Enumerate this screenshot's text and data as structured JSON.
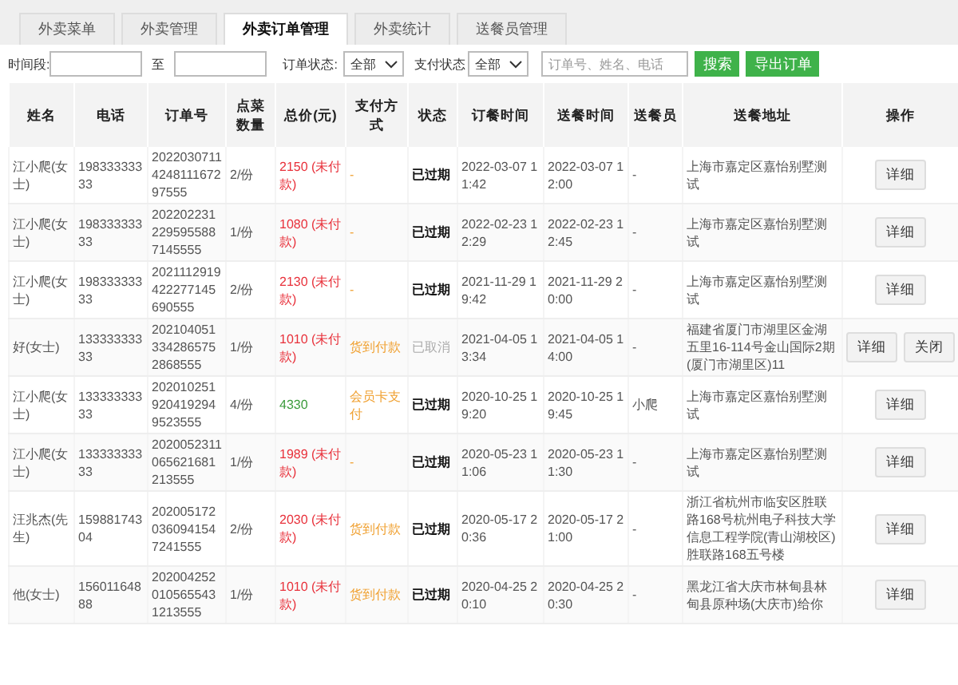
{
  "tabs": [
    {
      "label": "外卖菜单",
      "selected": false
    },
    {
      "label": "外卖管理",
      "selected": false
    },
    {
      "label": "外卖订单管理",
      "selected": true
    },
    {
      "label": "外卖统计",
      "selected": false
    },
    {
      "label": "送餐员管理",
      "selected": false
    }
  ],
  "filters": {
    "period_label": "时间段:",
    "to_label": "至",
    "order_status_label": "订单状态:",
    "order_status_value": "全部",
    "pay_status_label": "支付状态",
    "pay_status_value": "全部",
    "search_placeholder": "订单号、姓名、电话",
    "search_button": "搜索",
    "export_button": "导出订单"
  },
  "table": {
    "columns": [
      "姓名",
      "电话",
      "订单号",
      "点菜数量",
      "总价(元)",
      "支付方式",
      "状态",
      "订餐时间",
      "送餐时间",
      "送餐员",
      "送餐地址",
      "操作"
    ],
    "rows": [
      {
        "name": "江小爬(女士)",
        "phone": "19833333333",
        "order_no": "2022030711424811167297555",
        "quantity": "2/份",
        "total": "2150 (未付款)",
        "paid": false,
        "payment": "-",
        "status": "已过期",
        "cancelled": false,
        "order_time": "2022-03-07 11:42",
        "delivery_time": "2022-03-07 12:00",
        "courier": "-",
        "address": "上海市嘉定区嘉怡别墅测试",
        "actions": [
          "详细"
        ]
      },
      {
        "name": "江小爬(女士)",
        "phone": "19833333333",
        "order_no": "2022022312295955887145555",
        "quantity": "1/份",
        "total": "1080 (未付款)",
        "paid": false,
        "payment": "-",
        "status": "已过期",
        "cancelled": false,
        "order_time": "2022-02-23 12:29",
        "delivery_time": "2022-02-23 12:45",
        "courier": "-",
        "address": "上海市嘉定区嘉怡别墅测试",
        "actions": [
          "详细"
        ]
      },
      {
        "name": "江小爬(女士)",
        "phone": "19833333333",
        "order_no": "2021112919422277145690555",
        "quantity": "2/份",
        "total": "2130 (未付款)",
        "paid": false,
        "payment": "-",
        "status": "已过期",
        "cancelled": false,
        "order_time": "2021-11-29 19:42",
        "delivery_time": "2021-11-29 20:00",
        "courier": "-",
        "address": "上海市嘉定区嘉怡别墅测试",
        "actions": [
          "详细"
        ]
      },
      {
        "name": "好(女士)",
        "phone": "13333333333",
        "order_no": "2021040513342865752868555",
        "quantity": "1/份",
        "total": "1010 (未付款)",
        "paid": false,
        "payment": "货到付款",
        "status": "已取消",
        "cancelled": true,
        "order_time": "2021-04-05 13:34",
        "delivery_time": "2021-04-05 14:00",
        "courier": "-",
        "address": "福建省厦门市湖里区金湖五里16-114号金山国际2期(厦门市湖里区)11",
        "actions": [
          "详细",
          "关闭"
        ]
      },
      {
        "name": "江小爬(女士)",
        "phone": "13333333333",
        "order_no": "2020102519204192949523555",
        "quantity": "4/份",
        "total": "4330",
        "paid": true,
        "payment": "会员卡支付",
        "status": "已过期",
        "cancelled": false,
        "order_time": "2020-10-25 19:20",
        "delivery_time": "2020-10-25 19:45",
        "courier": "小爬",
        "address": "上海市嘉定区嘉怡别墅测试",
        "actions": [
          "详细"
        ]
      },
      {
        "name": "江小爬(女士)",
        "phone": "13333333333",
        "order_no": "2020052311065621681213555",
        "quantity": "1/份",
        "total": "1989 (未付款)",
        "paid": false,
        "payment": "-",
        "status": "已过期",
        "cancelled": false,
        "order_time": "2020-05-23 11:06",
        "delivery_time": "2020-05-23 11:30",
        "courier": "-",
        "address": "上海市嘉定区嘉怡别墅测试",
        "actions": [
          "详细"
        ]
      },
      {
        "name": "汪兆杰(先生)",
        "phone": "15988174304",
        "order_no": "2020051720360941547241555",
        "quantity": "2/份",
        "total": "2030 (未付款)",
        "paid": false,
        "payment": "货到付款",
        "status": "已过期",
        "cancelled": false,
        "order_time": "2020-05-17 20:36",
        "delivery_time": "2020-05-17 21:00",
        "courier": "-",
        "address": "浙江省杭州市临安区胜联路168号杭州电子科技大学信息工程学院(青山湖校区)胜联路168五号楼",
        "actions": [
          "详细"
        ]
      },
      {
        "name": "他(女士)",
        "phone": "15601164888",
        "order_no": "2020042520105655431213555",
        "quantity": "1/份",
        "total": "1010 (未付款)",
        "paid": false,
        "payment": "货到付款",
        "status": "已过期",
        "cancelled": false,
        "order_time": "2020-04-25 20:10",
        "delivery_time": "2020-04-25 20:30",
        "courier": "-",
        "address": "黑龙江省大庆市林甸县林甸县原种场(大庆市)给你",
        "actions": [
          "详细"
        ]
      }
    ]
  }
}
